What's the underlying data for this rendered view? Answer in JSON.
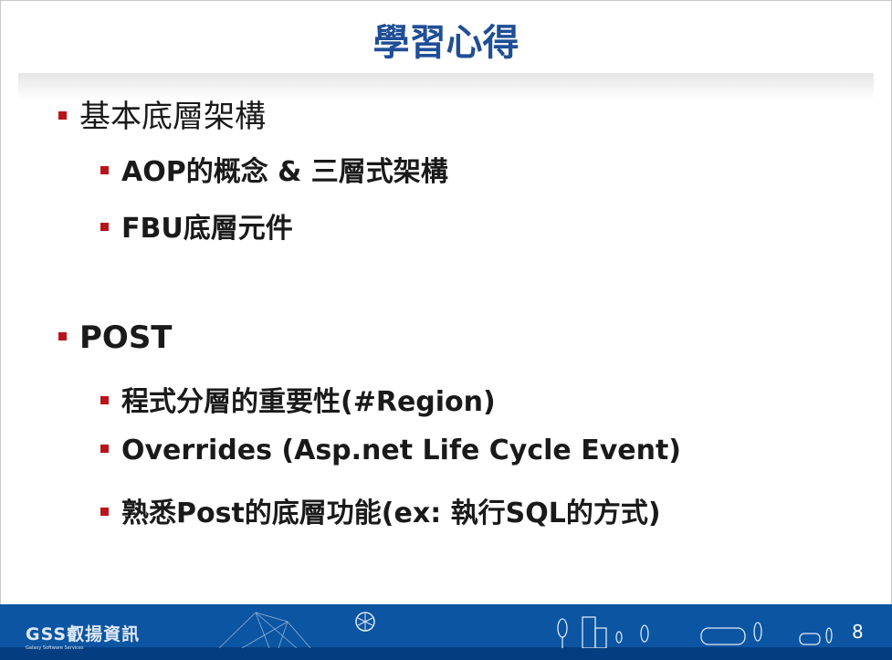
{
  "title": "學習心得",
  "sections": [
    {
      "label": "基本底層架構",
      "children": [
        "AOP的概念 & 三層式架構",
        "FBU底層元件"
      ]
    },
    {
      "label": "POST",
      "children": [
        "程式分層的重要性(#Region)",
        "Overrides (Asp.net Life Cycle Event)",
        "熟悉Post的底層功能(ex: 執行SQL的方式)"
      ]
    }
  ],
  "footer": {
    "logo": "GSS叡揚資訊",
    "logo_sub": "Galaxy Software Services",
    "page_number": "8"
  },
  "colors": {
    "title": "#1f4e96",
    "bullet": "#b8141b",
    "footer": "#0b55a3"
  }
}
